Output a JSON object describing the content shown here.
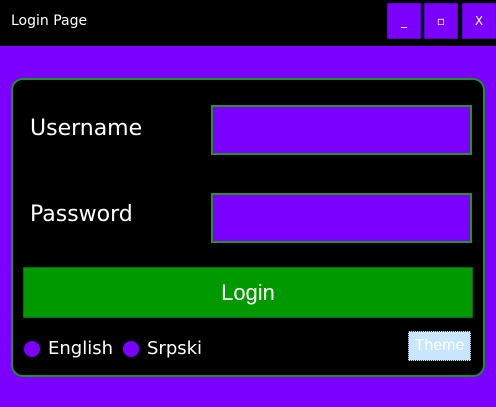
{
  "window": {
    "title": "Login Page",
    "min_label": "_",
    "max_label": "▫",
    "close_label": "X"
  },
  "form": {
    "username_label": "Username",
    "password_label": "Password",
    "username_value": "",
    "password_value": "",
    "login_label": "Login"
  },
  "languages": [
    {
      "label": "English"
    },
    {
      "label": "Srpski"
    }
  ],
  "theme_label": "Theme",
  "colors": {
    "accent": "#7b00ff",
    "login_green": "#009900",
    "panel_bg": "#000000",
    "border_green": "#2c8f2e"
  }
}
